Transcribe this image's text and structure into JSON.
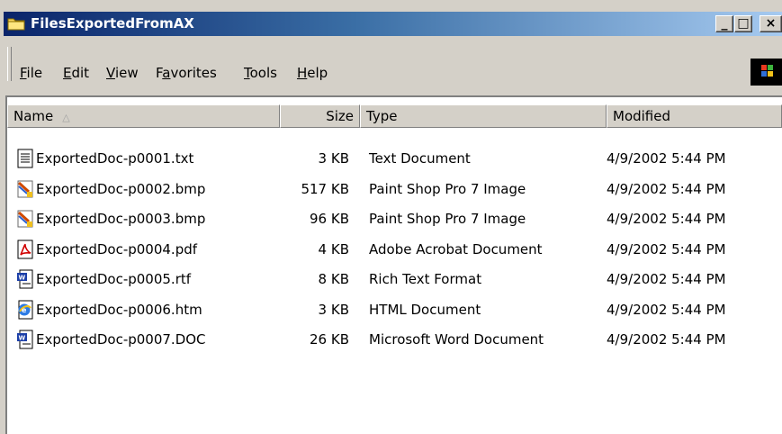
{
  "window": {
    "title": "FilesExportedFromAX",
    "minimize_glyph": "_",
    "maximize_glyph": "□",
    "close_glyph": "×"
  },
  "menu": {
    "items": [
      {
        "label": "File",
        "accel": "F"
      },
      {
        "label": "Edit",
        "accel": "E"
      },
      {
        "label": "View",
        "accel": "V"
      },
      {
        "label": "Favorites",
        "accel": "a"
      },
      {
        "label": "Tools",
        "accel": "T"
      },
      {
        "label": "Help",
        "accel": "H"
      }
    ]
  },
  "columns": {
    "name": "Name",
    "size": "Size",
    "type": "Type",
    "modified": "Modified",
    "sort_indicator": "△"
  },
  "files": [
    {
      "name": "ExportedDoc-p0001.txt",
      "size": "3 KB",
      "type": "Text Document",
      "modified": "4/9/2002 5:44 PM",
      "icon": "text-document-icon"
    },
    {
      "name": "ExportedDoc-p0002.bmp",
      "size": "517 KB",
      "type": "Paint Shop Pro 7 Image",
      "modified": "4/9/2002 5:44 PM",
      "icon": "paint-shop-pro-icon"
    },
    {
      "name": "ExportedDoc-p0003.bmp",
      "size": "96 KB",
      "type": "Paint Shop Pro 7 Image",
      "modified": "4/9/2002 5:44 PM",
      "icon": "paint-shop-pro-icon"
    },
    {
      "name": "ExportedDoc-p0004.pdf",
      "size": "4 KB",
      "type": "Adobe Acrobat Document",
      "modified": "4/9/2002 5:44 PM",
      "icon": "acrobat-pdf-icon"
    },
    {
      "name": "ExportedDoc-p0005.rtf",
      "size": "8 KB",
      "type": "Rich Text Format",
      "modified": "4/9/2002 5:44 PM",
      "icon": "word-document-icon"
    },
    {
      "name": "ExportedDoc-p0006.htm",
      "size": "3 KB",
      "type": "HTML Document",
      "modified": "4/9/2002 5:44 PM",
      "icon": "html-document-icon"
    },
    {
      "name": "ExportedDoc-p0007.DOC",
      "size": "26 KB",
      "type": "Microsoft Word Document",
      "modified": "4/9/2002 5:44 PM",
      "icon": "word-document-icon"
    }
  ]
}
